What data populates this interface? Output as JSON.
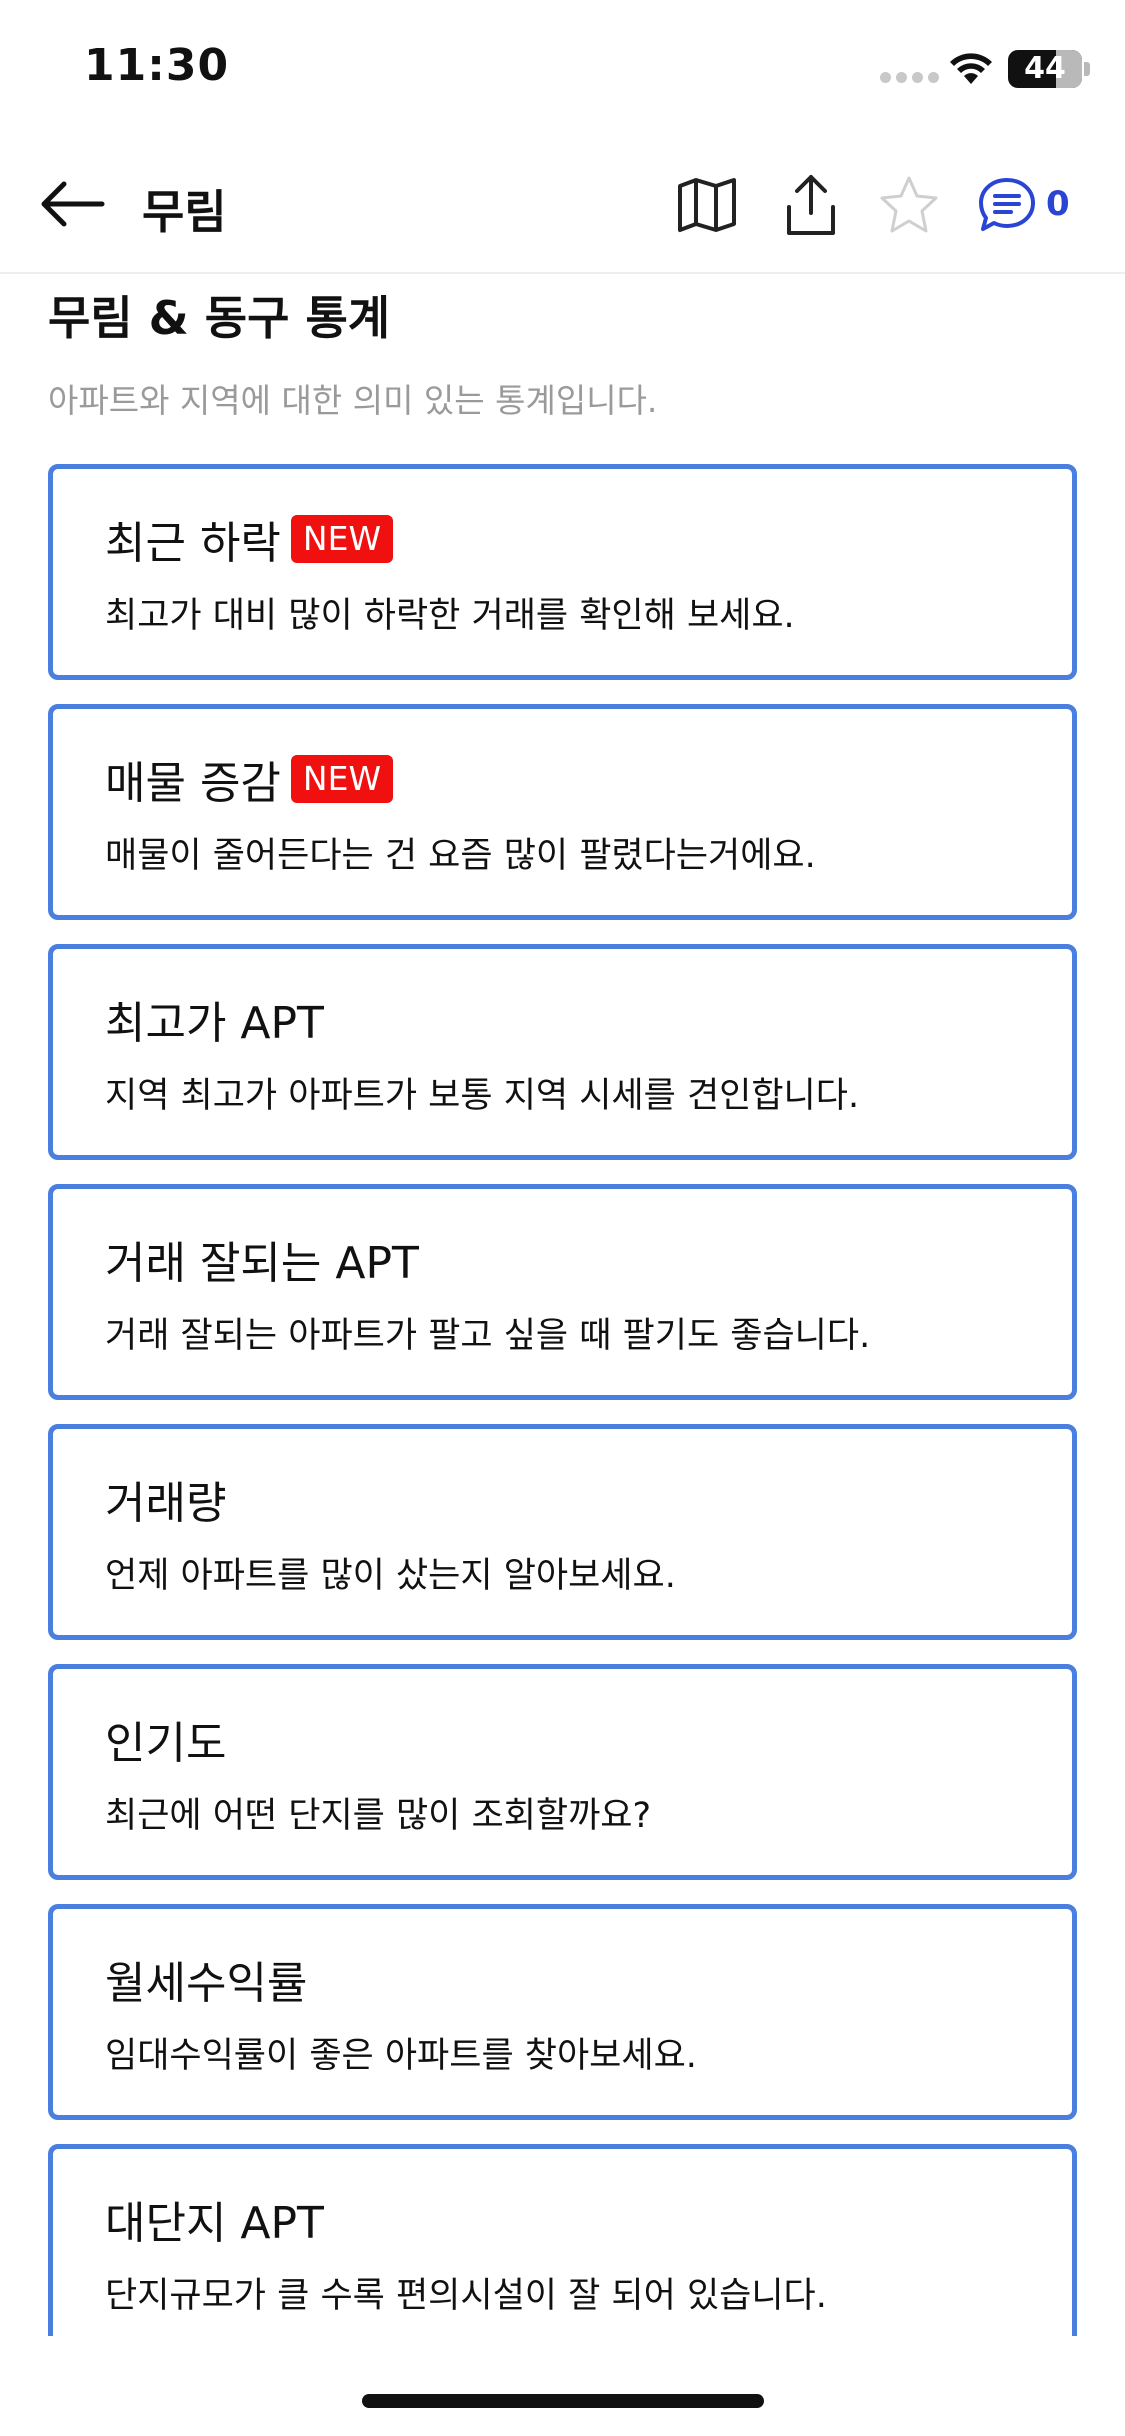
{
  "status_bar": {
    "time": "11:30",
    "battery_level": "44"
  },
  "nav": {
    "title": "무림",
    "comment_count": "0"
  },
  "section": {
    "title": "무림 & 동구 통계",
    "subtitle": "아파트와 지역에 대한 의미 있는 통계입니다."
  },
  "cards": [
    {
      "title": "최근 하락",
      "badge": "NEW",
      "desc": "최고가 대비 많이 하락한 거래를 확인해 보세요."
    },
    {
      "title": "매물 증감",
      "badge": "NEW",
      "desc": "매물이 줄어든다는 건 요즘 많이 팔렸다는거에요."
    },
    {
      "title": "최고가 APT",
      "desc": "지역 최고가 아파트가 보통 지역 시세를 견인합니다."
    },
    {
      "title": "거래 잘되는 APT",
      "desc": "거래 잘되는 아파트가 팔고 싶을 때 팔기도 좋습니다."
    },
    {
      "title": "거래량",
      "desc": "언제 아파트를 많이 샀는지 알아보세요."
    },
    {
      "title": "인기도",
      "desc": "최근에 어떤 단지를 많이 조회할까요?"
    },
    {
      "title": "월세수익률",
      "desc": "임대수익률이 좋은 아파트를 찾아보세요."
    },
    {
      "title": "대단지 APT",
      "desc": "단지규모가 클 수록 편의시설이 잘 되어 있습니다."
    }
  ],
  "colors": {
    "accent": "#4a7fe0",
    "badge": "#f01010",
    "comment": "#2a44d4"
  }
}
